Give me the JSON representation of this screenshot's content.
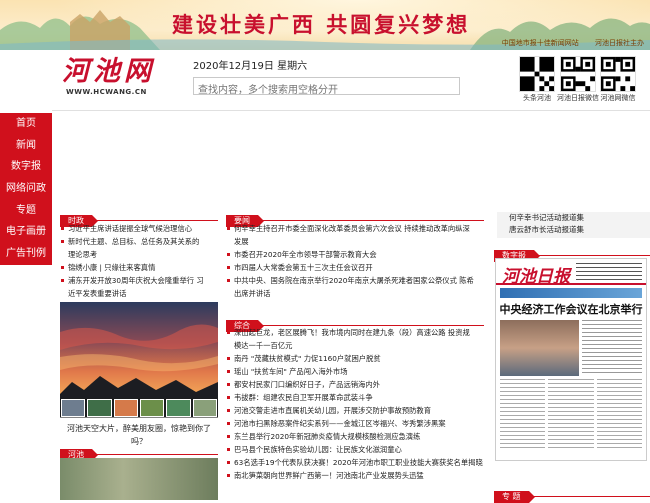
{
  "banner": {
    "slogan": "建设壮美广西  共圆复兴梦想",
    "links": [
      "中国地市报十佳新闻网站",
      "河池日报社主办"
    ]
  },
  "logo": {
    "mark": "河池网",
    "sub": "WWW.HCWANG.CN"
  },
  "date": "2020年12月19日 星期六",
  "search": {
    "placeholder": "查找内容，多个搜索用空格分开"
  },
  "qr": [
    "头条河池",
    "河池日报微信",
    "河池网微信"
  ],
  "nav": [
    "首页",
    "新闻",
    "数字报",
    "网络问政",
    "专题",
    "电子画册",
    "广告刊例"
  ],
  "sections": {
    "shizheng": "时政",
    "yaowen": "要闻",
    "zonghe": "综合",
    "hechi": "河池"
  },
  "shizheng_items": [
    {
      "t": "习近平主席讲话提振全球气候治理信心",
      "c": false
    },
    {
      "t": "新时代主题、总目标、总任务及其关系的",
      "c": false
    },
    {
      "t": "理论思考",
      "c": true
    },
    {
      "t": "锦绣小康 | 只缘往来客真情",
      "c": false
    },
    {
      "t": "浦东开发开放30周年庆祝大会隆重举行 习",
      "c": false
    },
    {
      "t": "近平发表重要讲话",
      "c": true
    }
  ],
  "yaowen_items": [
    {
      "t": "何辛幸主持召开市委全面深化改革委员会第六次会议 持续推动改革向纵深",
      "c": false
    },
    {
      "t": "发展",
      "c": true
    },
    {
      "t": "市委召开2020年全市领导干部警示教育大会",
      "c": false
    },
    {
      "t": "市四届人大常委会第五十三次主任会议召开",
      "c": false
    },
    {
      "t": "中共中央、国务院在南京举行2020年南京大屠杀死难者国家公祭仪式 陈希",
      "c": false
    },
    {
      "t": "出席并讲话",
      "c": true
    }
  ],
  "zonghe_items": [
    {
      "t": "深山起巨龙，老区展腾飞！我市境内同时在建九条（段）高速公路 投资规",
      "c": false
    },
    {
      "t": "模达一千一百亿元",
      "c": true
    },
    {
      "t": "南丹 \"茂藏扶贫模式\" 力促1160户就困户脱贫",
      "c": false
    },
    {
      "t": "瑶山 \"扶贫车间\" 产品闯入海外市场",
      "c": false
    },
    {
      "t": "都安村民家门口编织好日子，产品远销海内外",
      "c": false
    },
    {
      "t": "韦拔群：组建农民自卫军开展革命武装斗争",
      "c": false
    },
    {
      "t": "河池交警走进市直属机关幼儿园，开展涉交防护事故预防教育",
      "c": false
    },
    {
      "t": "河池市扫黑除恶案件纪实系列——金城江区岑福兴、岑秀繁涉黑案",
      "c": false
    },
    {
      "t": "东兰县举行2020年新冠肺炎疫情大规模核酸检测应急演练",
      "c": false
    },
    {
      "t": "巴马县个民族特色实验幼儿园：让民族文化滋润童心",
      "c": false
    },
    {
      "t": "63名选手19个代表队获决赛！2020年河池市职工职业技能大赛获奖名单揭晓",
      "c": false
    },
    {
      "t": "南北笋菜朝向世界鲜广西第一！河池南北产业发展势头迅猛",
      "c": false
    }
  ],
  "photo_caption": "河池天空大片，醉美朋友圈，惊艳到你了吗？",
  "right": {
    "links": [
      "何辛幸书记活动报道集",
      "唐云舒市长活动报道集"
    ],
    "paper_section": "数字报",
    "paper_name": "河池日报",
    "paper_headline": "中央经济工作会议在北京举行",
    "topic_section": "专 题"
  },
  "colors": {
    "brand_red": "#d0101c",
    "banner": "#fbe3b2"
  }
}
